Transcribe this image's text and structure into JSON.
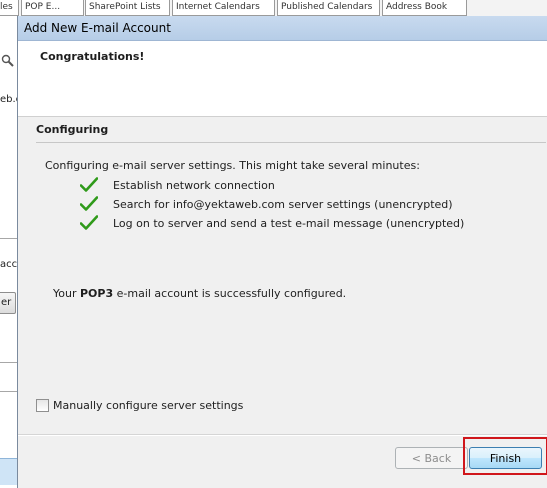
{
  "background": {
    "tabs": [
      "les",
      "POP E...",
      "SharePoint Lists",
      "Internet Calendars",
      "Published Calendars",
      "Address Book"
    ],
    "left_fragments": [
      "eb.c",
      "acco",
      "er"
    ]
  },
  "dialog": {
    "title": "Add New E-mail Account",
    "header": "Congratulations!",
    "section_title": "Configuring",
    "intro": "Configuring e-mail server settings. This might take several minutes:",
    "steps": [
      {
        "label": "Establish network connection",
        "icon": "check-icon",
        "status": "complete"
      },
      {
        "label": "Search for info@yektaweb.com server settings (unencrypted)",
        "icon": "check-icon",
        "status": "complete"
      },
      {
        "label": "Log on to server and send a test e-mail message (unencrypted)",
        "icon": "check-icon",
        "status": "complete"
      }
    ],
    "success_prefix": "Your ",
    "success_protocol": "POP3",
    "success_suffix": " e-mail account is successfully configured.",
    "manual_configure_label": "Manually configure server settings",
    "manual_configure_checked": false,
    "back_label": "< Back",
    "finish_label": "Finish"
  },
  "colors": {
    "check_green": "#2f9a1a",
    "highlight_red": "#d0161b",
    "titlebar": "#c8daef"
  }
}
